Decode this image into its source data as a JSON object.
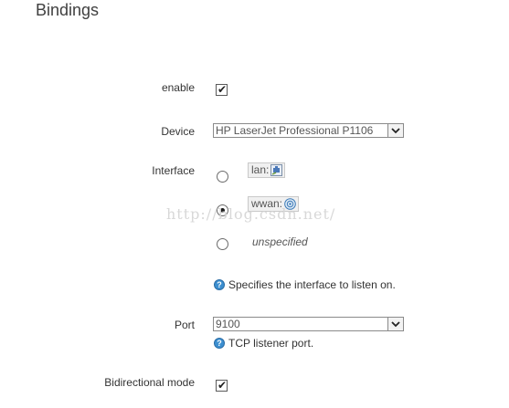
{
  "section": {
    "title": "Bindings"
  },
  "enable": {
    "label": "enable",
    "checked": true
  },
  "device": {
    "label": "Device",
    "value": "HP LaserJet Professional P1106"
  },
  "interface": {
    "label": "Interface",
    "options": [
      {
        "name": "lan:",
        "selected": false,
        "icon": "ethernet-icon"
      },
      {
        "name": "wwan:",
        "selected": true,
        "icon": "wireless-icon"
      },
      {
        "name": "unspecified",
        "selected": false
      }
    ],
    "help": "Specifies the interface to listen on."
  },
  "port": {
    "label": "Port",
    "value": "9100",
    "help": "TCP listener port."
  },
  "bidirectional": {
    "label": "Bidirectional mode",
    "checked": true
  },
  "watermark": "http://blog.csdn.net/",
  "colors": {
    "help_icon": "#3c8fd0",
    "text": "#333333",
    "title": "#404040"
  }
}
